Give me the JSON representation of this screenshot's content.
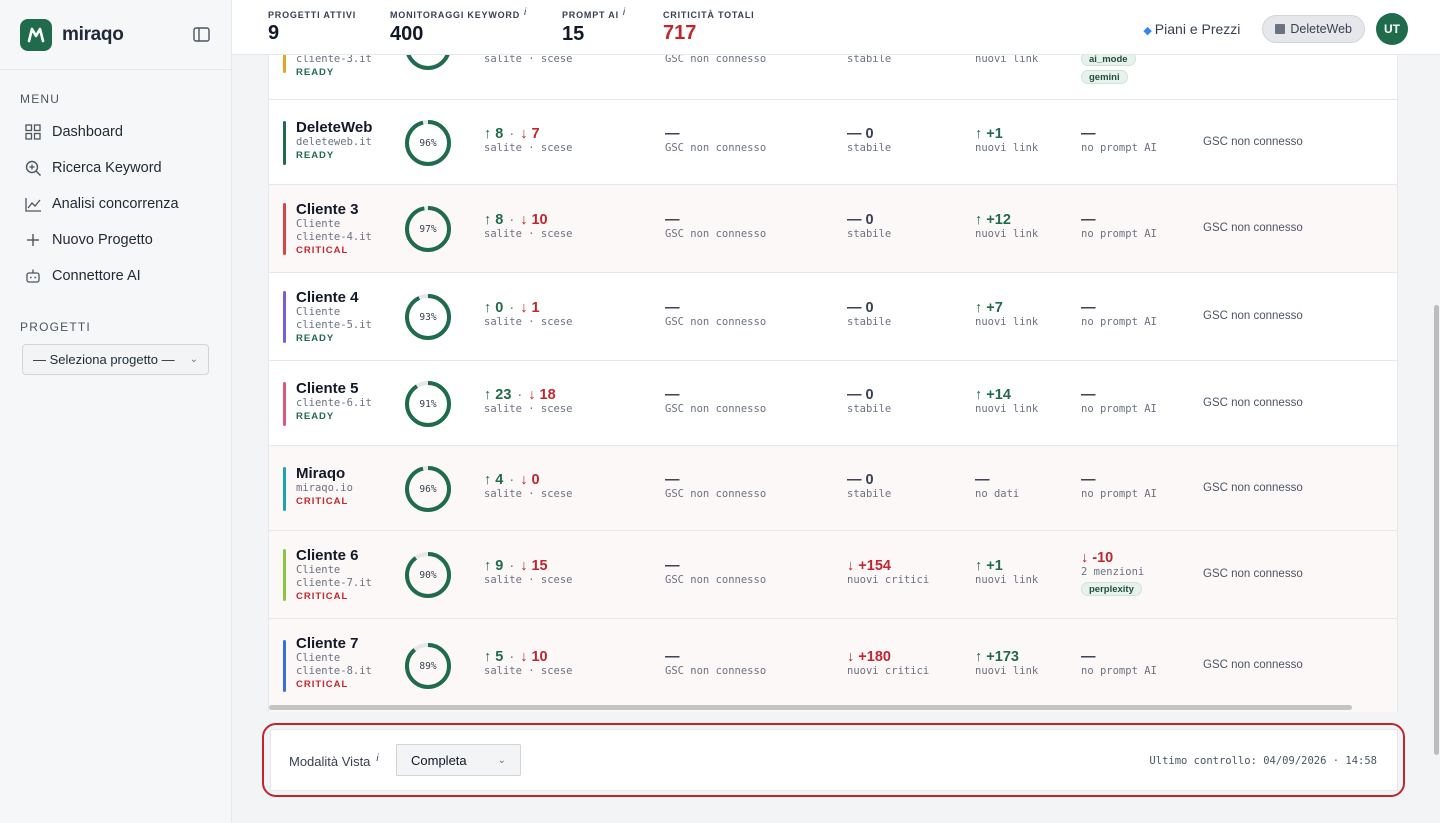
{
  "sidebar": {
    "brand": "miraqo",
    "menu_title": "MENU",
    "menu": [
      {
        "label": "Dashboard",
        "icon": "grid-icon"
      },
      {
        "label": "Ricerca Keyword",
        "icon": "search-plus-icon"
      },
      {
        "label": "Analisi concorrenza",
        "icon": "chart-line-icon"
      },
      {
        "label": "Nuovo Progetto",
        "icon": "plus-icon"
      },
      {
        "label": "Connettore AI",
        "icon": "robot-icon"
      }
    ],
    "projects_title": "PROGETTI",
    "project_select": "— Seleziona progetto —"
  },
  "topbar": {
    "stats": [
      {
        "label": "PROGETTI ATTIVI",
        "value": "9",
        "info": ""
      },
      {
        "label": "MONITORAGGI KEYWORD",
        "value": "400",
        "info": "i"
      },
      {
        "label": "PROMPT AI",
        "value": "15",
        "info": "i"
      },
      {
        "label": "CRITICITÀ TOTALI",
        "value": "717",
        "info": ""
      }
    ],
    "pricing": "Piani e Prezzi",
    "account": "DeleteWeb",
    "avatar": "UT"
  },
  "partial_row": {
    "domain": "cliente-3.it",
    "status": "READY",
    "kw_sub": "salite · scese",
    "gsc_sub": "GSC non connesso",
    "crit_sub": "stabile",
    "links_sub": "nuovi link",
    "tags": [
      "ai_mode",
      "gemini"
    ]
  },
  "rows": [
    {
      "name": "DeleteWeb",
      "type": "",
      "domain": "deleteweb.it",
      "status": "READY",
      "bar": "#1f6b4c",
      "score": "96%",
      "score_frac": 0.96,
      "kw_up": "8",
      "kw_down": "7",
      "kw_sub": "salite · scese",
      "gsc": "—",
      "gsc_sub": "GSC non connesso",
      "crit": "— 0",
      "crit_sub": "stabile",
      "crit_dir": "neutral",
      "links": "+1",
      "links_sub": "nuovi link",
      "links_dir": "up",
      "ai": "—",
      "ai_sub": "no prompt AI",
      "ai_dir": "neutral",
      "ai_tag": "",
      "gsc_status": "GSC non connesso"
    },
    {
      "name": "Cliente 3",
      "type": "Cliente",
      "domain": "cliente-4.it",
      "status": "CRITICAL",
      "bar": "#d64545",
      "score": "97%",
      "score_frac": 0.97,
      "kw_up": "8",
      "kw_down": "10",
      "kw_sub": "salite · scese",
      "gsc": "—",
      "gsc_sub": "GSC non connesso",
      "crit": "— 0",
      "crit_sub": "stabile",
      "crit_dir": "neutral",
      "links": "+12",
      "links_sub": "nuovi link",
      "links_dir": "up",
      "ai": "—",
      "ai_sub": "no prompt AI",
      "ai_dir": "neutral",
      "ai_tag": "",
      "gsc_status": "GSC non connesso"
    },
    {
      "name": "Cliente 4",
      "type": "Cliente",
      "domain": "cliente-5.it",
      "status": "READY",
      "bar": "#7b5cd6",
      "score": "93%",
      "score_frac": 0.93,
      "kw_up": "0",
      "kw_down": "1",
      "kw_sub": "salite · scese",
      "gsc": "—",
      "gsc_sub": "GSC non connesso",
      "crit": "— 0",
      "crit_sub": "stabile",
      "crit_dir": "neutral",
      "links": "+7",
      "links_sub": "nuovi link",
      "links_dir": "up",
      "ai": "—",
      "ai_sub": "no prompt AI",
      "ai_dir": "neutral",
      "ai_tag": "",
      "gsc_status": "GSC non connesso"
    },
    {
      "name": "Cliente 5",
      "type": "",
      "domain": "cliente-6.it",
      "status": "READY",
      "bar": "#e0567c",
      "score": "91%",
      "score_frac": 0.91,
      "kw_up": "23",
      "kw_down": "18",
      "kw_sub": "salite · scese",
      "gsc": "—",
      "gsc_sub": "GSC non connesso",
      "crit": "— 0",
      "crit_sub": "stabile",
      "crit_dir": "neutral",
      "links": "+14",
      "links_sub": "nuovi link",
      "links_dir": "up",
      "ai": "—",
      "ai_sub": "no prompt AI",
      "ai_dir": "neutral",
      "ai_tag": "",
      "gsc_status": "GSC non connesso"
    },
    {
      "name": "Miraqo",
      "type": "",
      "domain": "miraqo.io",
      "status": "CRITICAL",
      "bar": "#1ba3b0",
      "score": "96%",
      "score_frac": 0.96,
      "kw_up": "4",
      "kw_down": "0",
      "kw_sub": "salite · scese",
      "gsc": "—",
      "gsc_sub": "GSC non connesso",
      "crit": "— 0",
      "crit_sub": "stabile",
      "crit_dir": "neutral",
      "links": "—",
      "links_sub": "no dati",
      "links_dir": "neutral",
      "ai": "—",
      "ai_sub": "no prompt AI",
      "ai_dir": "neutral",
      "ai_tag": "",
      "gsc_status": "GSC non connesso"
    },
    {
      "name": "Cliente 6",
      "type": "Cliente",
      "domain": "cliente-7.it",
      "status": "CRITICAL",
      "bar": "#8cc63f",
      "score": "90%",
      "score_frac": 0.9,
      "kw_up": "9",
      "kw_down": "15",
      "kw_sub": "salite · scese",
      "gsc": "—",
      "gsc_sub": "GSC non connesso",
      "crit": "+154",
      "crit_sub": "nuovi critici",
      "crit_dir": "down",
      "links": "+1",
      "links_sub": "nuovi link",
      "links_dir": "up",
      "ai": "-10",
      "ai_sub": "2 menzioni",
      "ai_dir": "down",
      "ai_tag": "perplexity",
      "gsc_status": "GSC non connesso"
    },
    {
      "name": "Cliente 7",
      "type": "Cliente",
      "domain": "cliente-8.it",
      "status": "CRITICAL",
      "bar": "#3b6fd4",
      "score": "89%",
      "score_frac": 0.89,
      "kw_up": "5",
      "kw_down": "10",
      "kw_sub": "salite · scese",
      "gsc": "—",
      "gsc_sub": "GSC non connesso",
      "crit": "+180",
      "crit_sub": "nuovi critici",
      "crit_dir": "down",
      "links": "+173",
      "links_sub": "nuovi link",
      "links_dir": "up",
      "ai": "—",
      "ai_sub": "no prompt AI",
      "ai_dir": "neutral",
      "ai_tag": "",
      "gsc_status": "GSC non connesso"
    }
  ],
  "footer": {
    "view_label": "Modalità Vista",
    "view_info": "i",
    "view_value": "Completa",
    "last_check": "Ultimo controllo: 04/09/2026 · 14:58"
  },
  "colors": {
    "brand": "#1f6b4c",
    "critical": "#c0262d",
    "highlight": "#c0262d"
  }
}
